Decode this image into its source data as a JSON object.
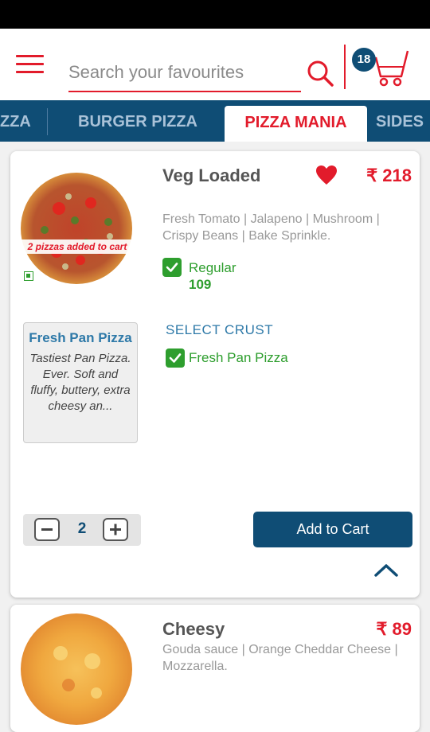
{
  "header": {
    "search_placeholder": "Search your favourites",
    "cart_count": "18"
  },
  "tabs": [
    {
      "label": "ZZA"
    },
    {
      "label": "BURGER PIZZA"
    },
    {
      "label": "PIZZA MANIA"
    },
    {
      "label": "SIDES"
    }
  ],
  "products": [
    {
      "name": "Veg Loaded",
      "price": "₹ 218",
      "description": "Fresh Tomato | Jalapeno | Mushroom | Crispy Beans | Bake Sprinkle.",
      "added_banner": "2 pizzas added to cart",
      "size_label": "Regular",
      "size_price": "109",
      "crust_heading": "SELECT CRUST",
      "crust_option": "Fresh Pan Pizza",
      "crust_box_title": "Fresh Pan Pizza",
      "crust_box_desc": "Tastiest Pan Pizza. Ever. Soft and fluffy, buttery, extra cheesy an...",
      "quantity": "2",
      "add_label": "Add to Cart"
    },
    {
      "name": "Cheesy",
      "price": "₹ 89",
      "description": "Gouda sauce | Orange Cheddar Cheese | Mozzarella."
    }
  ],
  "colors": {
    "brand_red": "#e21b2b",
    "brand_blue": "#0f4d75",
    "veg_green": "#2e9e2e"
  }
}
